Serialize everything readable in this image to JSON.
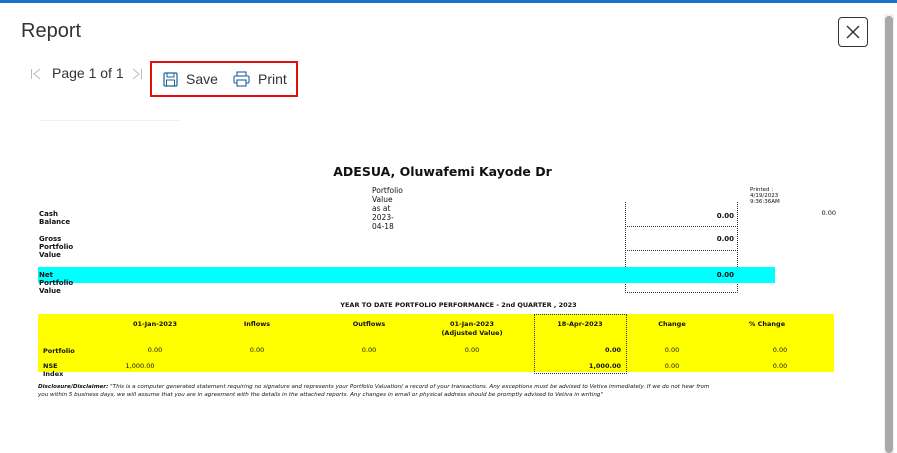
{
  "dialog": {
    "title": "Report",
    "close_label": "close"
  },
  "pager": {
    "text": "Page 1 of 1"
  },
  "toolbar": {
    "save_label": "Save",
    "print_label": "Print"
  },
  "report": {
    "client_name": "ADESUA, Oluwafemi Kayode Dr",
    "subtitle": "Portfolio Value as at  2023-04-18",
    "printed": "Printed : 4/19/2023  9:36:36AM",
    "side_value": "0.00",
    "summary": {
      "cash_balance_label": "Cash Balance",
      "cash_balance_value": "0.00",
      "gross_label": "Gross Portfolio Value",
      "gross_value": "0.00",
      "net_label": "Net Portfolio Value",
      "net_value": "0.00"
    },
    "performance": {
      "title": "YEAR TO DATE PORTFOLIO PERFORMANCE - 2nd QUARTER , 2023",
      "headers": [
        "01-Jan-2023",
        "Inflows",
        "Outflows",
        "01-Jan-2023",
        "18-Apr-2023",
        "Change",
        "% Change"
      ],
      "adjusted_note": "(Adjusted Value)",
      "rows": [
        {
          "label": "Portfolio",
          "values": [
            "0.00",
            "0.00",
            "0.00",
            "0.00",
            "0.00",
            "0.00",
            "0.00"
          ]
        },
        {
          "label": "NSE Index",
          "values": [
            "1,000.00",
            "",
            "",
            "",
            "1,000.00",
            "0.00",
            "0.00"
          ]
        }
      ]
    },
    "disclaimer_heading": "Disclosure/Disclaimer:",
    "disclaimer_text": " \"This is a computer generated statement requiring no signature and represents your Portfolio Valuation/ a record of your transactions. Any exceptions must be advised to Vetiva immediately. If we do not hear from you within 5 business days, we will assume that you are in agreement with the details in the attached reports.  Any changes in email or physical address should be promptly advised to Vetiva in writing\""
  },
  "colors": {
    "highlight_cyan": "#00ffff",
    "highlight_yellow": "#ffff00",
    "toolbar_outline": "#e01010",
    "accent": "#1a73c8"
  }
}
